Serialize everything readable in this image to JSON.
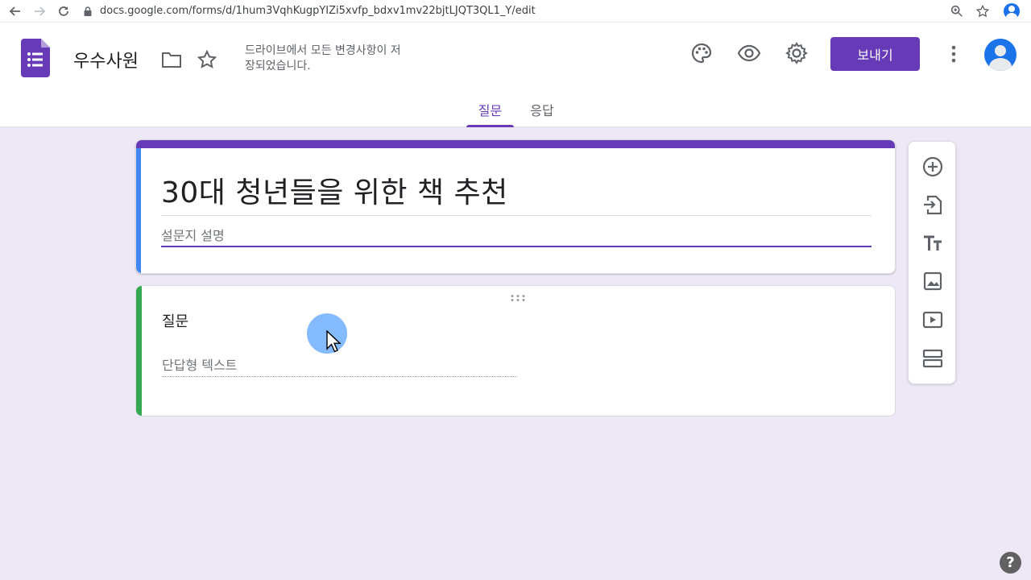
{
  "browser": {
    "url": "docs.google.com/forms/d/1hum3VqhKugpYIZi5xvfp_bdxv1mv22bjtLJQT3QL1_Y/edit"
  },
  "header": {
    "doc_title": "우수사원",
    "save_status": "드라이브에서 모든 변경사항이 저장되었습니다.",
    "send_label": "보내기"
  },
  "tabs": [
    {
      "label": "질문",
      "active": true
    },
    {
      "label": "응답",
      "active": false
    }
  ],
  "form": {
    "title": "30대 청년들을 위한 책 추천",
    "description_placeholder": "설문지 설명"
  },
  "question": {
    "title": "질문",
    "answer_placeholder": "단답형 텍스트"
  },
  "help": {
    "label": "?"
  },
  "colors": {
    "theme": "#673ab7",
    "background": "#ede7f6",
    "title_accent": "#4285f4",
    "question_accent": "#34a853"
  },
  "icons": [
    "palette-icon",
    "preview-eye-icon",
    "settings-gear-icon",
    "add-question-icon",
    "import-questions-icon",
    "add-title-icon",
    "add-image-icon",
    "add-video-icon",
    "add-section-icon"
  ]
}
